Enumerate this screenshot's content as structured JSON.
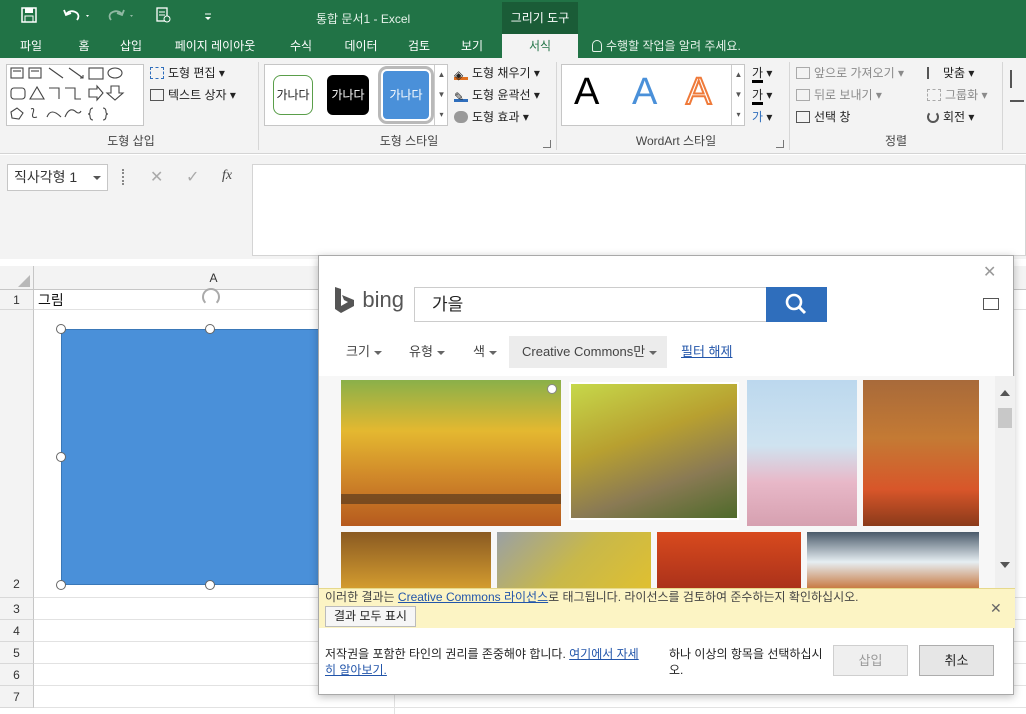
{
  "window": {
    "title": "통합 문서1 - Excel",
    "context_tab": "그리기 도구"
  },
  "tabs": [
    "파일",
    "홈",
    "삽입",
    "페이지 레이아웃",
    "수식",
    "데이터",
    "검토",
    "보기",
    "서식"
  ],
  "active_tab": "서식",
  "tell_me": "수행할 작업을 알려 주세요.",
  "ribbon": {
    "insert_shapes": {
      "label": "도형 삽입",
      "edit_shape": "도형 편집",
      "text_box": "텍스트 상자"
    },
    "shape_styles": {
      "label": "도형 스타일",
      "samples": [
        "가나다",
        "가나다",
        "가나다"
      ],
      "fill": "도형 채우기",
      "outline": "도형 윤곽선",
      "effects": "도형 효과"
    },
    "wordart": {
      "label": "WordArt 스타일",
      "samples": [
        "A",
        "A",
        "A"
      ],
      "text_fill_glyph": "가"
    },
    "arrange": {
      "label": "정렬",
      "bring_forward": "앞으로 가져오기",
      "send_backward": "뒤로 보내기",
      "selection_pane": "선택 창",
      "align": "맞춤",
      "group": "그룹화",
      "rotate": "회전"
    }
  },
  "formula_bar": {
    "name_box": "직사각형 1",
    "fx": "fx"
  },
  "sheet": {
    "column": "A",
    "rows": [
      "1",
      "2",
      "3",
      "4",
      "5",
      "6",
      "7"
    ],
    "a1": "그림"
  },
  "dialog": {
    "brand": "bing",
    "query": "가을",
    "filters": [
      "크기",
      "유형",
      "색"
    ],
    "cc_filter": "Creative Commons만",
    "clear_filter": "필터 해제",
    "notice_prefix": "이러한 결과는 ",
    "notice_link": "Creative Commons 라이선스",
    "notice_suffix": "로 태그됩니다. 라이선스를 검토하여 준수하는지 확인하십시오.",
    "show_all": "결과 모두 표시",
    "copyright_text": "저작권을 포함한 타인의 권리를 존중해야 합니다. ",
    "copyright_link": "여기에서 자세히 알아보기.",
    "select_hint": "하나 이상의 항목을 선택하십시오.",
    "insert": "삽입",
    "cancel": "취소"
  }
}
